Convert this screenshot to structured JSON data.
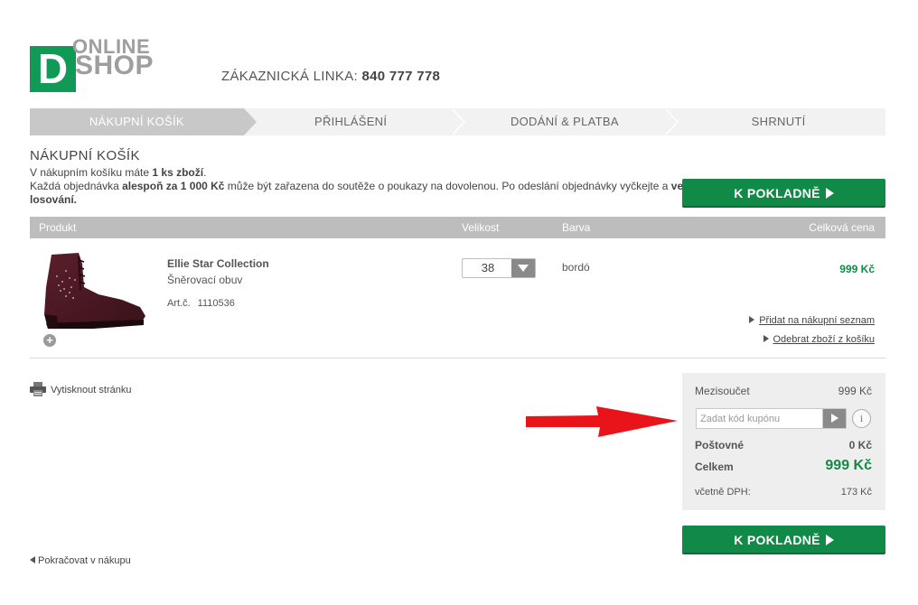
{
  "header": {
    "logo_letter": "D",
    "logo_online": "ONLINE",
    "logo_shop": "SHOP",
    "hotline_label": "ZÁKAZNICKÁ LINKA:",
    "hotline_number": "840 777 778"
  },
  "steps": [
    {
      "label": "NÁKUPNÍ KOŠÍK",
      "active": true
    },
    {
      "label": "PŘIHLÁŠENÍ",
      "active": false
    },
    {
      "label": "DODÁNÍ & PLATBA",
      "active": false
    },
    {
      "label": "SHRNUTÍ",
      "active": false
    }
  ],
  "cart": {
    "title": "NÁKUPNÍ KOŠÍK",
    "info_prefix": "V nákupním košíku máte ",
    "info_count": "1 ks zboží",
    "info_suffix": ".",
    "promo_prefix": "Každá objednávka ",
    "promo_bold": "alespoň za 1 000 Kč",
    "promo_text": " může být zařazena do soutěže o poukazy na dovolenou. Po odeslání objednávky vyčkejte a ",
    "promo_cut": "ve",
    "promo_line2": "losování."
  },
  "checkout_button": "K POKLADNĚ",
  "table": {
    "col_product": "Produkt",
    "col_size": "Velikost",
    "col_color": "Barva",
    "col_price": "Celková cena"
  },
  "product": {
    "name": "Ellie Star Collection",
    "type": "Šněrovací obuv",
    "art_label": "Art.č.",
    "art_number": "1110536",
    "size": "38",
    "color": "bordó",
    "price": "999 Kč",
    "image_icon": "burgundy-ankle-boot-image"
  },
  "links": {
    "wishlist": "Přidat na nákupní seznam",
    "remove": "Odebrat zboží z košíku",
    "print": "Vytisknout stránku",
    "continue": "Pokračovat v nákupu"
  },
  "summary": {
    "subtotal_label": "Mezisoučet",
    "subtotal_value": "999 Kč",
    "coupon_placeholder": "Zadat kód kupónu",
    "info_glyph": "i",
    "shipping_label": "Poštovné",
    "shipping_value": "0 Kč",
    "total_label": "Celkem",
    "total_value": "999 Kč",
    "vat_label": "včetně DPH:",
    "vat_value": "173 Kč"
  },
  "colors": {
    "brand_green": "#109a55",
    "button_green": "#128a47",
    "annotation_red": "#e8141a"
  }
}
